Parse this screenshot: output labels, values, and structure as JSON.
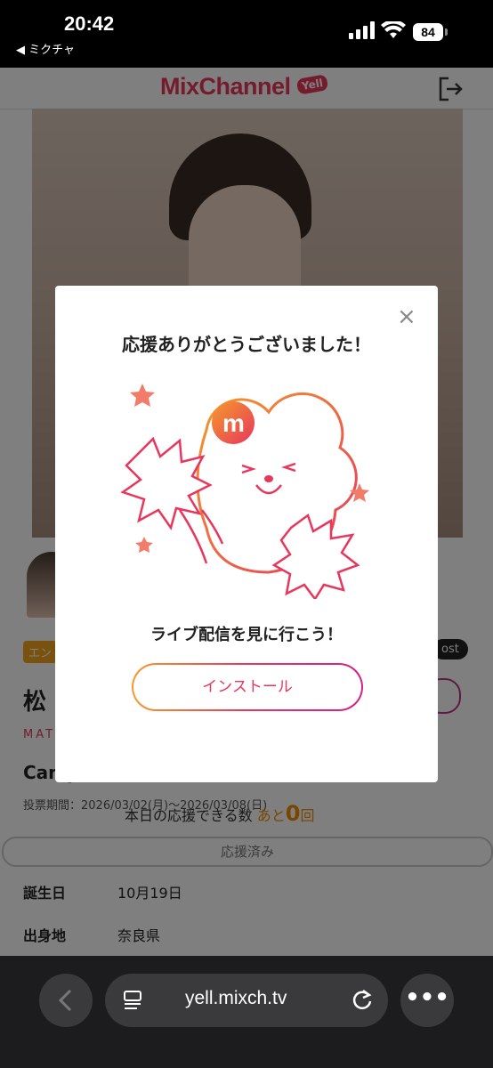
{
  "status_bar": {
    "time": "20:42",
    "back_app": "◀ ミクチャ",
    "battery": "84"
  },
  "header": {
    "logo_text": "MixChannel",
    "logo_badge": "Yell",
    "logout_icon": "logout-icon"
  },
  "profile": {
    "category": "エン",
    "name": "松",
    "romaji": "MAT",
    "campaign": "Camp",
    "vote_period": "投票期間：2026/03/02(月)～2026/03/08(日)",
    "remaining_label": "本日の応援できる数",
    "remaining_prefix": "あと",
    "remaining_count": "0",
    "remaining_suffix": "回",
    "post_chip": "ost",
    "voted_button": "応援済み",
    "birthday_label": "誕生日",
    "birthday_value": "10月19日",
    "hometown_label": "出身地",
    "hometown_value": "奈良県"
  },
  "modal": {
    "close_label": "×",
    "title": "応援ありがとうございました！",
    "subtitle": "ライブ配信を見に行こう！",
    "install_button": "インストール"
  },
  "browser": {
    "url": "yell.mixch.tv",
    "more_label": "•••"
  },
  "colors": {
    "brand_pink": "#e8365d",
    "accent_orange": "#f08c00",
    "overlay": "rgba(0,0,0,0.5)"
  }
}
